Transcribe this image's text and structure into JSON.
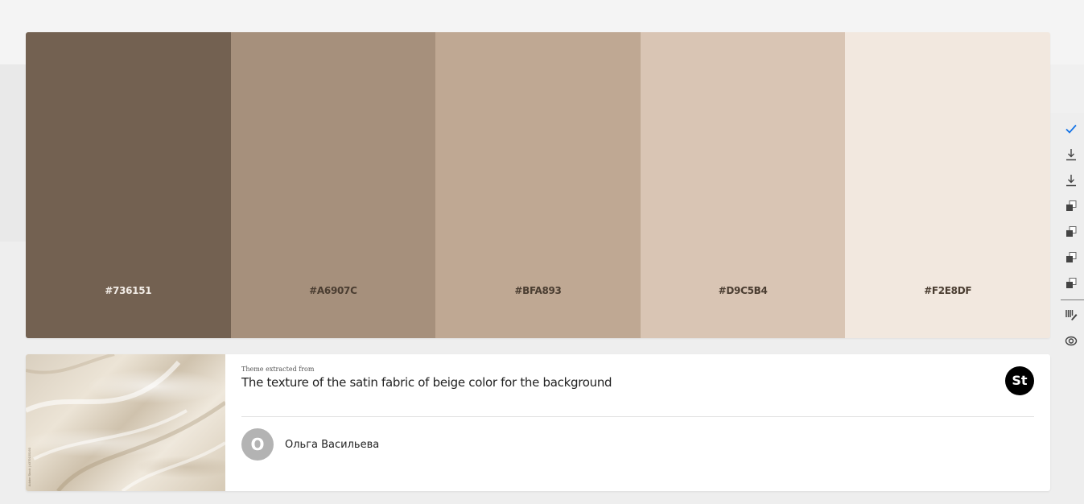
{
  "palette": {
    "swatches": [
      {
        "hex": "#736151",
        "color": "#736151",
        "text_color": "#f2ece6"
      },
      {
        "hex": "#A6907C",
        "color": "#A6907C",
        "text_color": "#4a3d31"
      },
      {
        "hex": "#BFA893",
        "color": "#BFA893",
        "text_color": "#4a3d31"
      },
      {
        "hex": "#D9C5B4",
        "color": "#D9C5B4",
        "text_color": "#4a3d31"
      },
      {
        "hex": "#F2E8DF",
        "color": "#F2E8DF",
        "text_color": "#4a3d31"
      }
    ]
  },
  "source": {
    "label": "Theme extracted from",
    "title": "The texture of the satin fabric of beige color for the background",
    "badge": "St",
    "thumbnail_watermark": "Adobe Stock | #379155160"
  },
  "author": {
    "initial": "О",
    "name": "Ольга Васильева"
  },
  "toolbar": {
    "icons": [
      "check-icon",
      "download-icon",
      "download-icon",
      "copy-icon",
      "copy-icon",
      "copy-icon",
      "copy-icon",
      "edit-palette-icon",
      "creative-cloud-icon"
    ],
    "accent": "#1473e6"
  }
}
